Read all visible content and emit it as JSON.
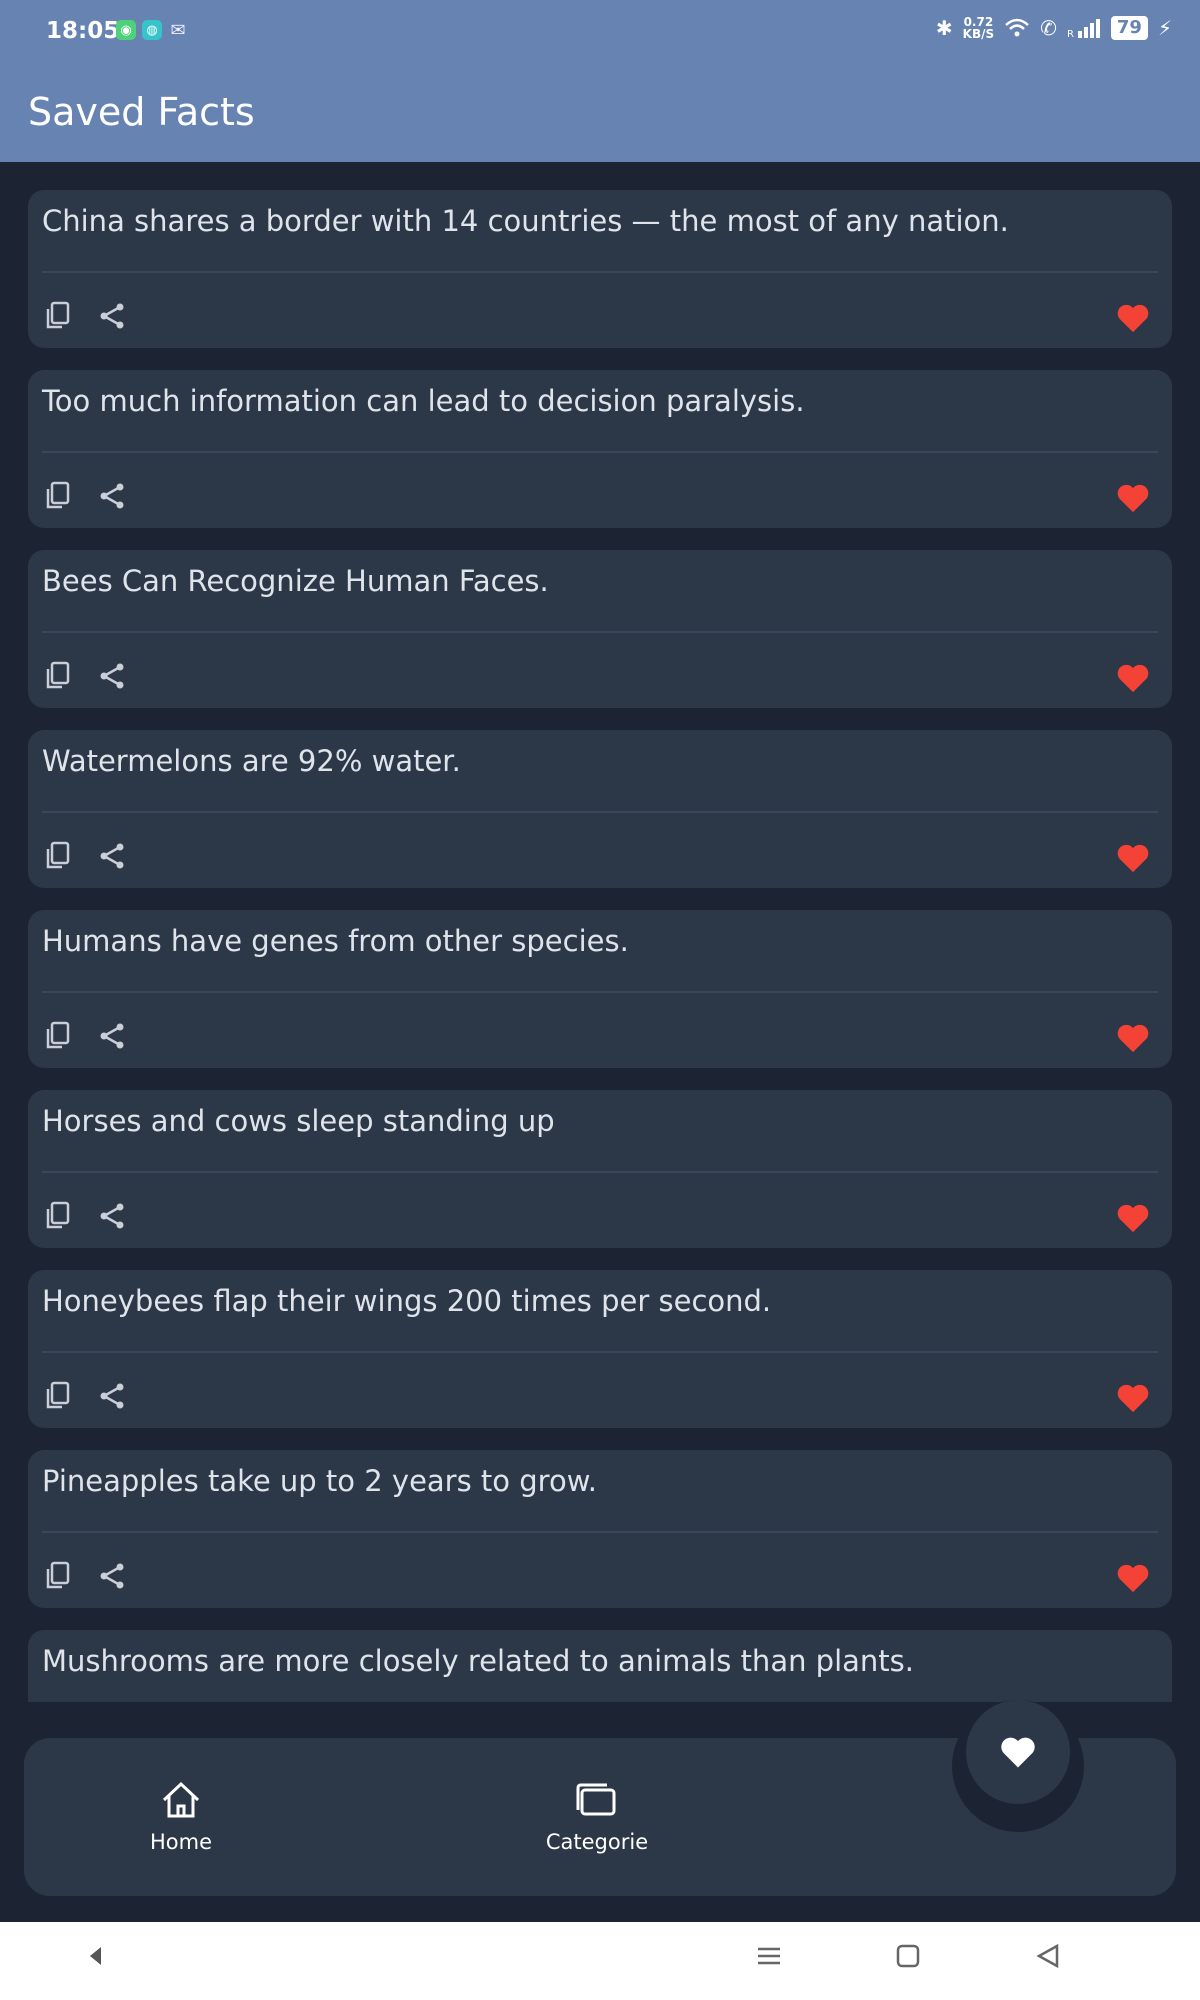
{
  "status_bar": {
    "time": "18:05",
    "speed_top": "0.72",
    "speed_bottom": "KB/S",
    "battery": "79"
  },
  "app_bar": {
    "title": "Saved Facts"
  },
  "facts": [
    "China shares a border with 14 countries — the most of any nation.",
    "Too much information can lead to decision paralysis.",
    "Bees Can Recognize Human Faces.",
    "Watermelons are 92% water.",
    "Humans have genes from other species.",
    "Horses and cows sleep standing up",
    "Honeybees flap their wings 200 times per second.",
    "Pineapples take up to 2 years to grow.",
    "Mushrooms are more closely related to animals than plants."
  ],
  "bottom_nav": {
    "home_label": "Home",
    "categories_label": "Categorie"
  },
  "colors": {
    "app_bar": "#6683b2",
    "background": "#1c2434",
    "card": "#2c3748",
    "favorite": "#f44336"
  },
  "icons": [
    "copy-icon",
    "share-icon",
    "heart-icon",
    "home-icon",
    "categories-icon"
  ]
}
